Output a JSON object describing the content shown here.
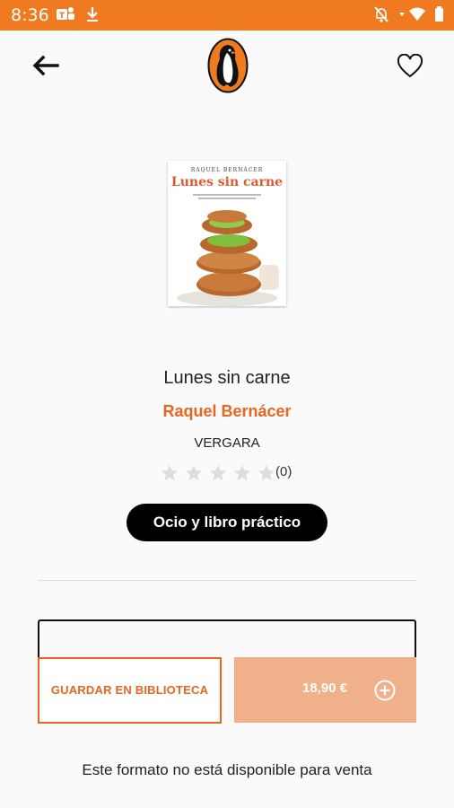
{
  "status_bar": {
    "time": "8:36",
    "icons": [
      "teams-icon",
      "download-icon",
      "notifications-off-icon",
      "wifi-icon",
      "battery-icon"
    ]
  },
  "app_bar": {
    "back_icon": "arrow-left-icon",
    "logo": "penguin-logo",
    "favorite_icon": "heart-outline-icon"
  },
  "book": {
    "cover": {
      "author": "RAQUEL BERNÁCER",
      "title": "Lunes sin carne"
    },
    "title": "Lunes sin carne",
    "author": "Raquel Bernácer",
    "publisher": "VERGARA",
    "rating": {
      "stars": 0,
      "max_stars": 5,
      "count": "(0)"
    },
    "category": "Ocio y libro práctico"
  },
  "actions": {
    "save_label": "GUARDAR EN BIBLIOTECA",
    "price": "18,90 €",
    "availability_note": "Este formato no está disponible para venta"
  },
  "colors": {
    "brand": "#f07a1f",
    "accent": "#e8661f",
    "buy_button": "#f0b08a",
    "category_pill": "#000000",
    "star_empty": "#dddddd"
  }
}
